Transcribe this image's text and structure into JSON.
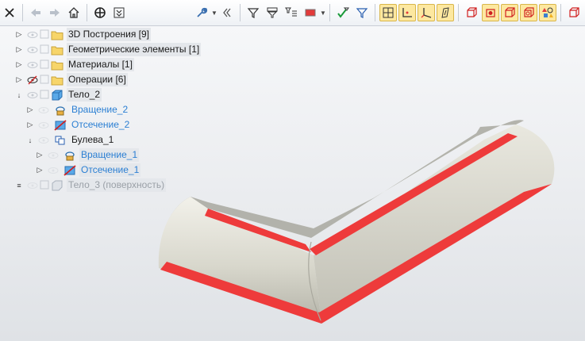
{
  "toolbar": {
    "buttons": [
      "close-icon",
      "back-arrow-icon",
      "forward-arrow-icon",
      "home-icon",
      "target-icon",
      "collapse-icon",
      "wrench-icon",
      "double-chevron-left-icon",
      "filter-icon",
      "filter-list-icon",
      "filter-tree-icon",
      "color-rect-icon",
      "check-filter-icon",
      "filter-icon-2",
      "grid-view-icon",
      "axis-icon",
      "axis-icon-2",
      "sketch-icon",
      "solid-icon",
      "solid-red-icon",
      "solid-icon-2",
      "solid-icon-3",
      "solid-icon-4",
      "shapes-icon",
      "solid-icon-5"
    ]
  },
  "tree": {
    "items": [
      {
        "label": "3D Построения [9]",
        "expander": "▷",
        "visible": true,
        "icon": "folder-icon",
        "style": "box"
      },
      {
        "label": "Геометрические элементы [1]",
        "expander": "▷",
        "visible": true,
        "icon": "folder-icon",
        "style": "box"
      },
      {
        "label": "Материалы [1]",
        "expander": "▷",
        "visible": true,
        "icon": "folder-icon",
        "style": "box"
      },
      {
        "label": "Операции [6]",
        "expander": "▷",
        "visible": false,
        "icon": "folder-icon",
        "style": "box"
      },
      {
        "label": "Тело_2",
        "expander": "↓",
        "visible": true,
        "icon": "body-cube-icon",
        "style": "box"
      },
      {
        "label": "Вращение_2",
        "expander": "▷",
        "icon": "revolve-icon",
        "style": "blue"
      },
      {
        "label": "Отсечение_2",
        "expander": "▷",
        "icon": "cut-icon",
        "style": "blue"
      },
      {
        "label": "Булева_1",
        "expander": "↓",
        "icon": "boolean-icon",
        "style": "normal"
      },
      {
        "label": "Вращение_1",
        "expander": "▷",
        "icon": "revolve-icon",
        "style": "blue-box"
      },
      {
        "label": "Отсечение_1",
        "expander": "▷",
        "icon": "cut-icon",
        "style": "blue-box"
      },
      {
        "label": "Тело_3 (поверхность)",
        "expander": "≡",
        "icon": "surface-icon",
        "style": "gray-box"
      }
    ]
  },
  "colors": {
    "model_body": "#d4d3c8",
    "model_section": "#ee3b3b",
    "highlight": "#fde8a0",
    "blue_text": "#2b7fd3"
  }
}
